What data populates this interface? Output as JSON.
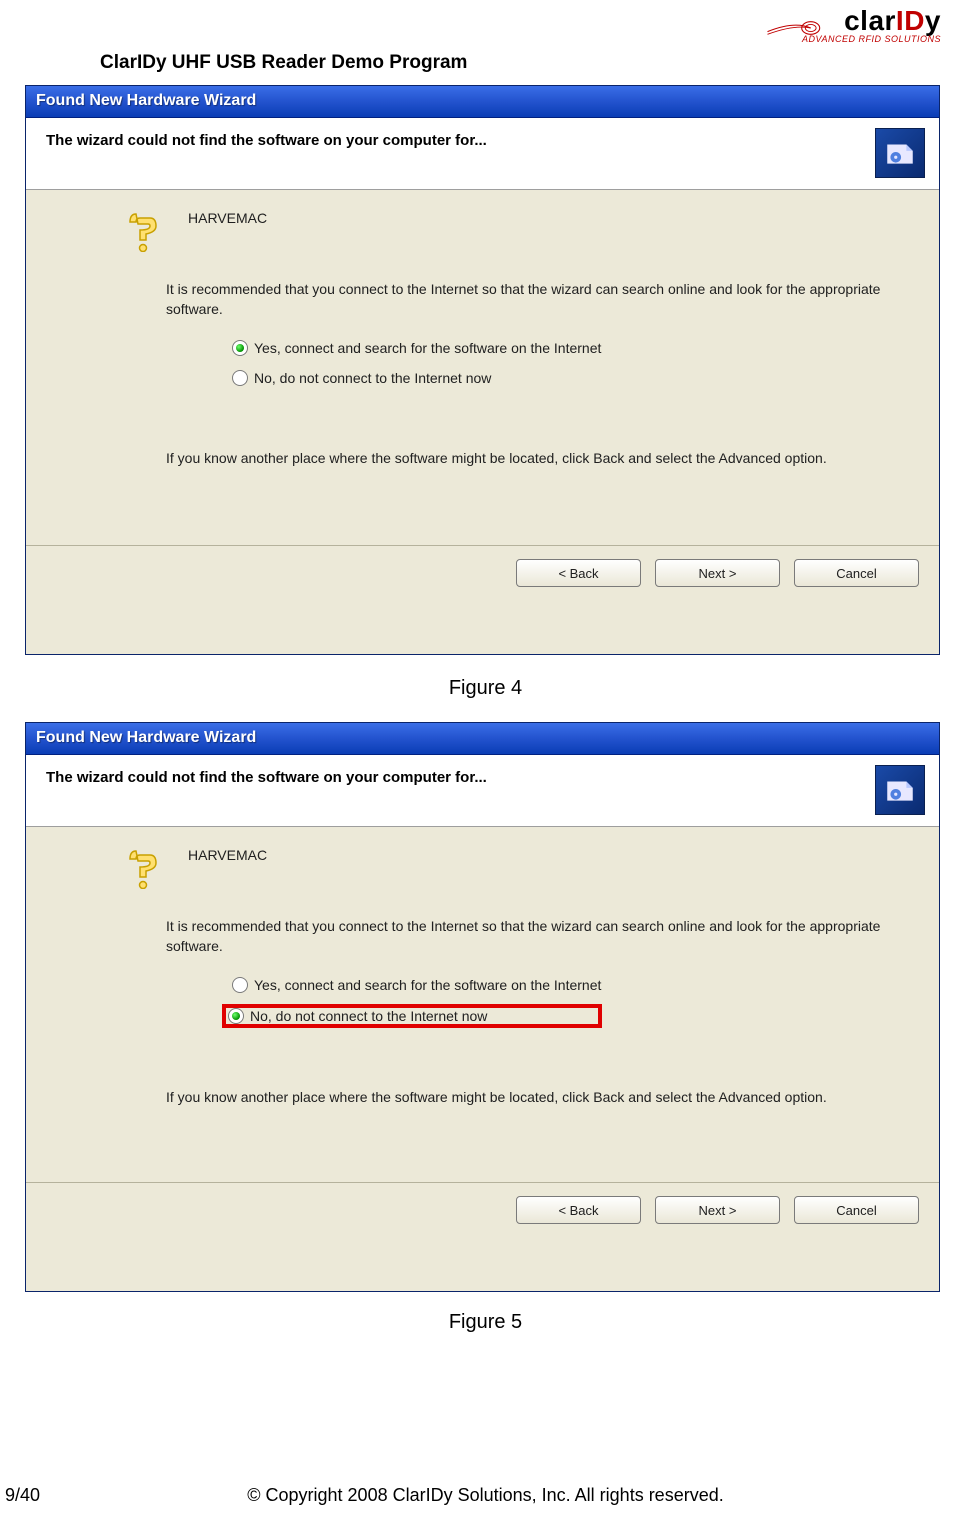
{
  "logo": {
    "part1": "clar",
    "part2": "ID",
    "part3": "y",
    "tagline": "ADVANCED RFID SOLUTIONS"
  },
  "doc_title": "ClarIDy UHF USB Reader Demo Program",
  "dialog": {
    "title": "Found New Hardware Wizard",
    "heading": "The wizard could not find the software on your computer for...",
    "device_name": "HARVEMAC",
    "recommend_text": "It is recommended that you connect to the Internet so that the wizard can search online and look for the appropriate software.",
    "option_yes": "Yes, connect and search for the software on the Internet",
    "option_no": "No, do not connect to the Internet now",
    "hint_text": "If you know another place where the software might be located, click Back and select the Advanced option.",
    "buttons": {
      "back": "< Back",
      "next": "Next >",
      "cancel": "Cancel"
    }
  },
  "fig1_selected": "yes",
  "fig2_selected": "no",
  "captions": {
    "fig1": "Figure 4",
    "fig2": "Figure 5"
  },
  "footer": {
    "page": "9/40",
    "copyright": "© Copyright 2008 ClarIDy Solutions, Inc. All rights reserved."
  }
}
